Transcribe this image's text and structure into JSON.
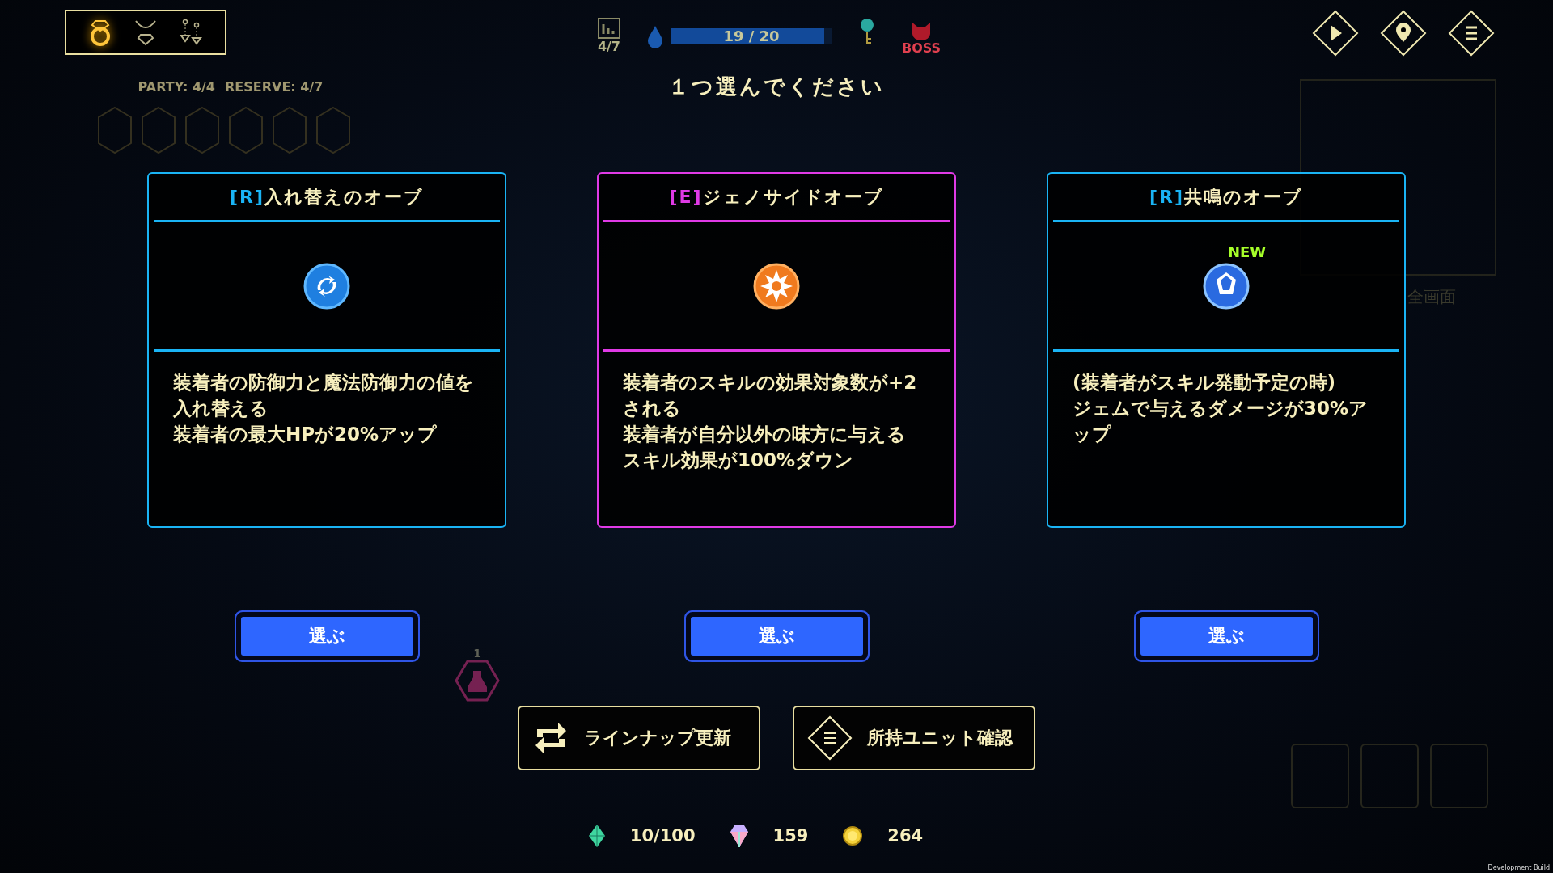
{
  "accessory_tabs": [
    {
      "kind": "ring",
      "selected": true
    },
    {
      "kind": "necklace",
      "selected": false
    },
    {
      "kind": "earrings",
      "selected": false
    }
  ],
  "hud": {
    "floor": "4/7",
    "water": {
      "reading": "19 / 20",
      "level": 0.95
    },
    "boss": "BOSS"
  },
  "party": {
    "party": "PARTY: 4/4",
    "reserve": "RESERVE: 4/7"
  },
  "minimap": {
    "fullscreen": "全画面"
  },
  "potion_count": "1",
  "title": "１つ選んでください",
  "cards": [
    {
      "rarity": "[R]",
      "name": "入れ替えのオーブ",
      "color": "#1ab4f5",
      "kind": "swap",
      "description": [
        "装着者の防御力と魔法防御力の値を入れ替える",
        "装着者の最大HPが20%アップ"
      ],
      "select": "選ぶ"
    },
    {
      "rarity": "[E]",
      "name": "ジェノサイドオーブ",
      "color": "#e03ae6",
      "kind": "burst",
      "description": [
        "装着者のスキルの効果対象数が+2される",
        "装着者が自分以外の味方に与えるスキル効果が100%ダウン"
      ],
      "select": "選ぶ"
    },
    {
      "rarity": "[R]",
      "name": "共鳴のオーブ",
      "color": "#1ab4f5",
      "kind": "crystal",
      "badge": "NEW",
      "description": [
        "(装着者がスキル発動予定の時)",
        "ジェムで与えるダメージが30%アップ"
      ],
      "select": "選ぶ"
    }
  ],
  "actions": [
    {
      "kind": "refresh",
      "label": "ラインナップ更新"
    },
    {
      "kind": "units",
      "label": "所持ユニット確認"
    }
  ],
  "currency": [
    {
      "kind": "gem",
      "value": "10/100"
    },
    {
      "kind": "prism",
      "value": "159"
    },
    {
      "kind": "coin",
      "value": "264"
    }
  ],
  "build_label": "Development Build"
}
